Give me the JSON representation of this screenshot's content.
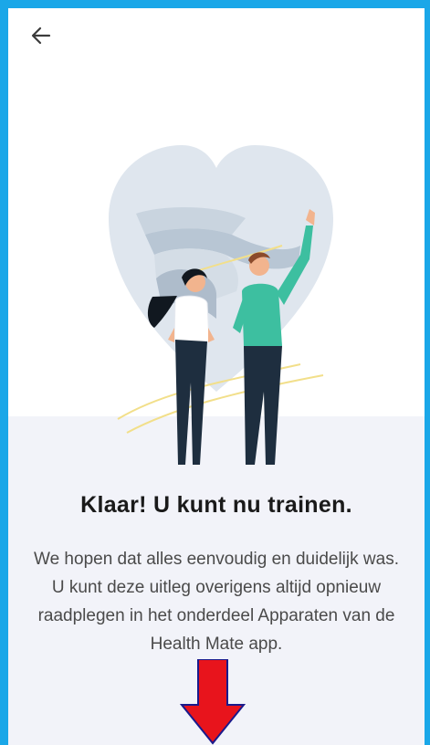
{
  "nav": {
    "back_icon": "arrow-left-icon"
  },
  "illustration": {
    "name": "two-people-heart-illustration"
  },
  "content": {
    "title": "Klaar! U kunt nu trainen.",
    "body": "We hopen dat alles eenvoudig en duidelijk was. U kunt deze uitleg overigens altijd opnieuw raadplegen in het onderdeel Apparaten van de Health Mate app."
  },
  "overlay": {
    "arrow_icon": "arrow-down-icon",
    "arrow_color": "#e8141c",
    "frame_color": "#1aa7e8"
  }
}
